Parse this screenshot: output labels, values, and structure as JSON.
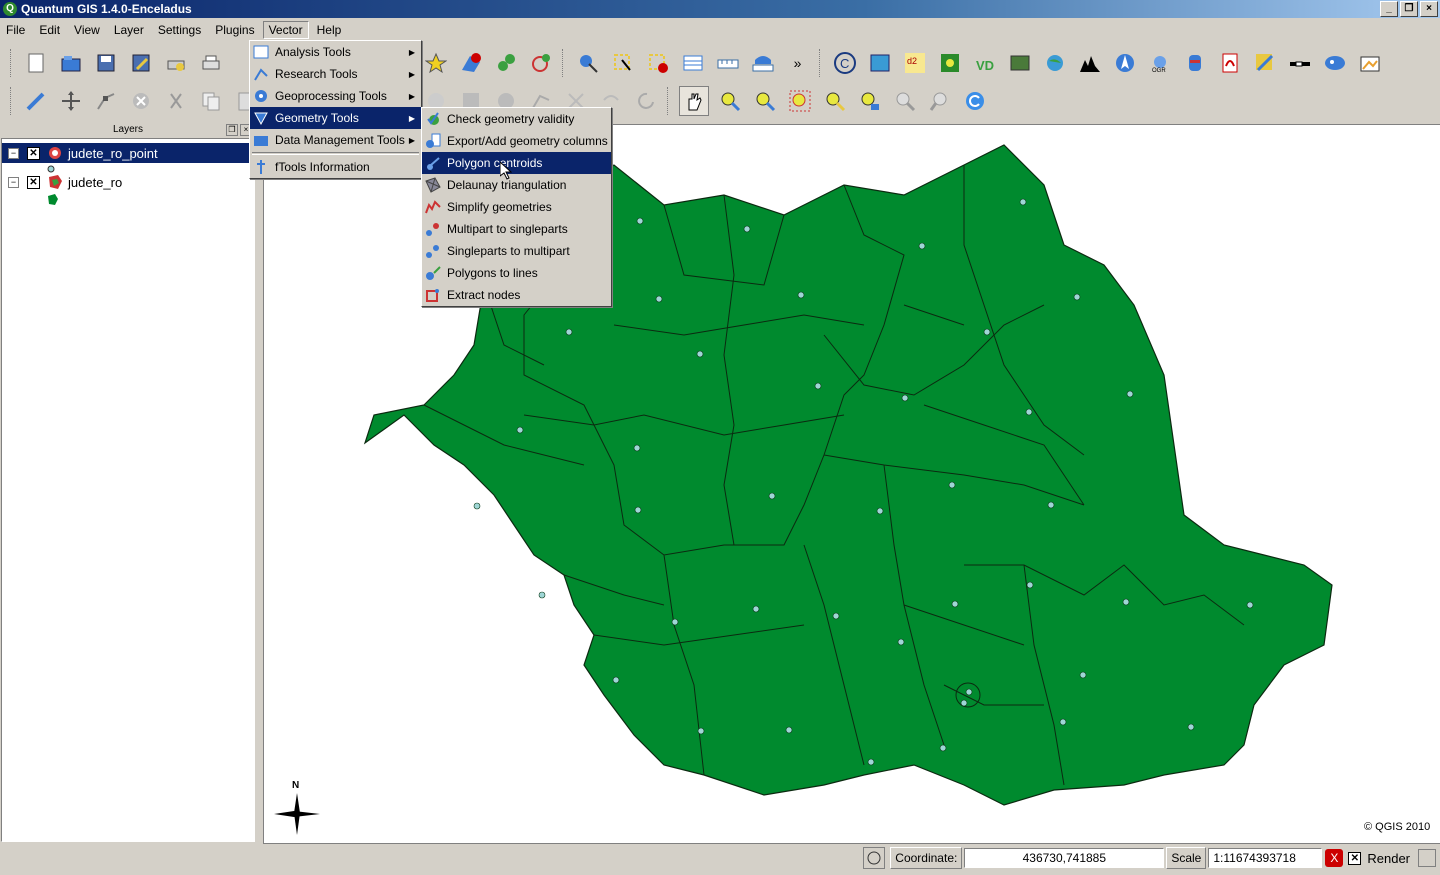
{
  "window": {
    "title": "Quantum GIS 1.4.0-Enceladus",
    "buttons": [
      "_",
      "❐",
      "×"
    ]
  },
  "menubar": {
    "items": [
      "File",
      "Edit",
      "View",
      "Layer",
      "Settings",
      "Plugins",
      "Vector",
      "Help"
    ],
    "active": "Vector"
  },
  "layers_panel": {
    "title": "Layers",
    "layers": [
      {
        "name": "judete_ro_point",
        "checked": true,
        "selected": true,
        "icon": "point-layer-icon"
      },
      {
        "name": "judete_ro",
        "checked": true,
        "selected": false,
        "icon": "polygon-layer-icon"
      }
    ]
  },
  "vector_menu": {
    "items": [
      {
        "label": "Analysis Tools",
        "submenu": true,
        "icon": "analysis-icon"
      },
      {
        "label": "Research Tools",
        "submenu": true,
        "icon": "research-icon"
      },
      {
        "label": "Geoprocessing Tools",
        "submenu": true,
        "icon": "geoprocessing-icon"
      },
      {
        "label": "Geometry Tools",
        "submenu": true,
        "highlighted": true,
        "icon": "geometry-icon"
      },
      {
        "label": "Data Management Tools",
        "submenu": true,
        "icon": "data-management-icon"
      },
      {
        "label": "fTools Information",
        "submenu": false,
        "icon": "info-icon"
      }
    ]
  },
  "geometry_submenu": {
    "items": [
      {
        "label": "Check geometry validity",
        "icon": "validity-icon"
      },
      {
        "label": "Export/Add geometry columns",
        "icon": "export-columns-icon"
      },
      {
        "label": "Polygon centroids",
        "highlighted": true,
        "icon": "centroid-icon"
      },
      {
        "label": "Delaunay triangulation",
        "icon": "delaunay-icon"
      },
      {
        "label": "Simplify geometries",
        "icon": "simplify-icon"
      },
      {
        "label": "Multipart to singleparts",
        "icon": "multi-to-single-icon"
      },
      {
        "label": "Singleparts to multipart",
        "icon": "single-to-multi-icon"
      },
      {
        "label": "Polygons to lines",
        "icon": "polygon-to-lines-icon"
      },
      {
        "label": "Extract nodes",
        "icon": "extract-nodes-icon"
      }
    ]
  },
  "map": {
    "fill_color": "#008a2e",
    "point_color": "#9fd6d6",
    "north_label": "N",
    "copyright": "© QGIS 2010"
  },
  "statusbar": {
    "coordinate_label": "Coordinate:",
    "coordinate_value": "436730,741885",
    "scale_label": "Scale",
    "scale_value": "1:11674393718",
    "render_label": "Render"
  },
  "colors": {
    "highlight": "#0a246a",
    "map_fill": "#008a2e"
  }
}
